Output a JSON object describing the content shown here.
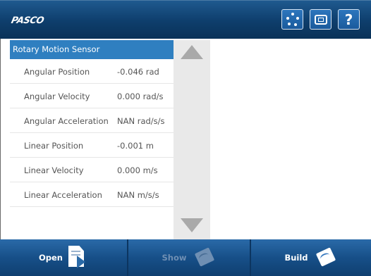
{
  "header": {
    "logo": "PASCO"
  },
  "panel": {
    "title": "Rotary Motion Sensor",
    "rows": [
      {
        "name": "Angular Position",
        "value": "-0.046 rad"
      },
      {
        "name": "Angular Velocity",
        "value": "0.000 rad/s"
      },
      {
        "name": "Angular Acceleration",
        "value": "NAN rad/s/s"
      },
      {
        "name": "Linear Position",
        "value": "-0.001 m"
      },
      {
        "name": "Linear Velocity",
        "value": "0.000 m/s"
      },
      {
        "name": "Linear Acceleration",
        "value": "NAN m/s/s"
      }
    ]
  },
  "footer": {
    "open_label": "Open",
    "show_label": "Show",
    "build_label": "Build"
  },
  "icons": {
    "sensor_dots": "dots-grid-icon",
    "device": "device-icon",
    "help": "?"
  },
  "colors": {
    "header_blue": "#0e3e6c",
    "selected_blue": "#2f7fc0",
    "footer_blue": "#174f88"
  }
}
